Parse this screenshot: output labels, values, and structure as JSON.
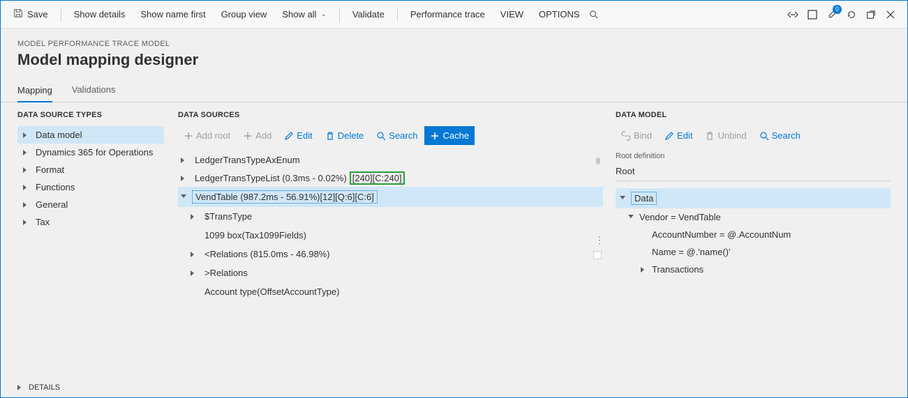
{
  "toolbar": {
    "save": "Save",
    "show_details": "Show details",
    "show_name_first": "Show name first",
    "group_view": "Group view",
    "show_all": "Show all",
    "validate": "Validate",
    "perf_trace": "Performance trace",
    "view": "VIEW",
    "options": "OPTIONS",
    "badge_count": "0"
  },
  "heading": {
    "context": "MODEL PERFORMANCE TRACE MODEL",
    "title": "Model mapping designer"
  },
  "tabs": {
    "mapping": "Mapping",
    "validations": "Validations"
  },
  "left": {
    "title": "DATA SOURCE TYPES",
    "items": [
      "Data model",
      "Dynamics 365 for Operations",
      "Format",
      "Functions",
      "General",
      "Tax"
    ]
  },
  "mid": {
    "title": "DATA SOURCES",
    "actions": {
      "add_root": "Add root",
      "add": "Add",
      "edit": "Edit",
      "delete": "Delete",
      "search": "Search",
      "cache": "Cache"
    },
    "items": {
      "ledger_enum": "LedgerTransTypeAxEnum",
      "ledger_list_a": "LedgerTransTypeList (0.3ms - 0.02%)",
      "ledger_list_b": "[240][C:240]",
      "vendtable": "VendTable (987.2ms - 56.91%)[12][Q:6][C:6]",
      "transtype": "$TransType",
      "box1099": "1099 box(Tax1099Fields)",
      "rel_lt": "<Relations (815.0ms - 46.98%)",
      "rel_gt": ">Relations",
      "account_type": "Account type(OffsetAccountType)"
    }
  },
  "right": {
    "title": "DATA MODEL",
    "actions": {
      "bind": "Bind",
      "edit": "Edit",
      "unbind": "Unbind",
      "search": "Search"
    },
    "root_label": "Root definition",
    "root_value": "Root",
    "tree": {
      "data": "Data",
      "vendor": "Vendor = VendTable",
      "acct": "AccountNumber = @.AccountNum",
      "name": "Name = @.'name()'",
      "trans": "Transactions"
    }
  },
  "details": "DETAILS"
}
